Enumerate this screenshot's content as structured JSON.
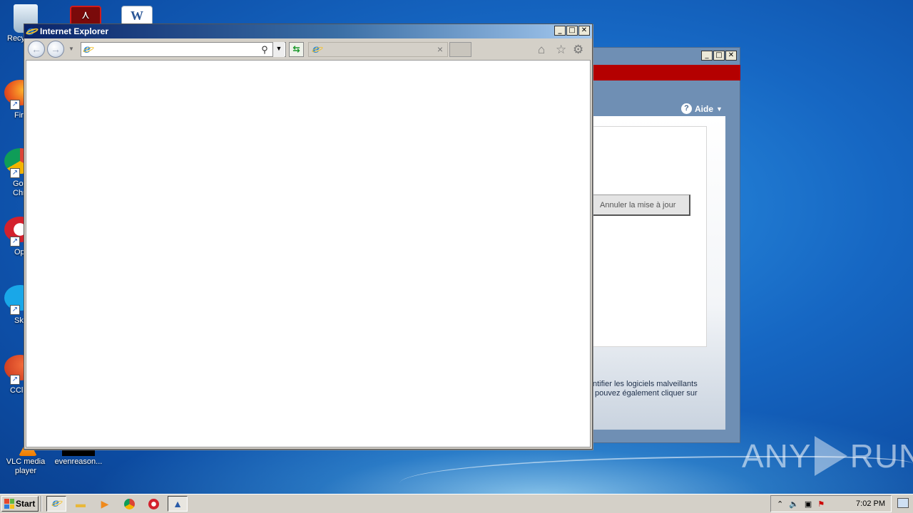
{
  "desktop": {
    "top_icons": [
      {
        "label": "Recy",
        "icon": "recycle-bin-icon"
      },
      {
        "label": "",
        "icon": "acrobat-icon"
      },
      {
        "label": "",
        "icon": "word-document-icon"
      }
    ],
    "left_icons": [
      {
        "label": "Fir",
        "icon": "firefox-icon",
        "color": "#e8561f"
      },
      {
        "label": "Go Chr",
        "icon": "chrome-icon",
        "color": "#2fa84f"
      },
      {
        "label": "Op",
        "icon": "opera-icon",
        "color": "#d3212d"
      },
      {
        "label": "Sk",
        "icon": "skype-icon",
        "color": "#19a7e8"
      },
      {
        "label": "CCl",
        "icon": "ccleaner-icon",
        "color": "#d84a2a"
      }
    ],
    "bottom_icons": [
      {
        "label": "VLC media player",
        "icon": "vlc-icon"
      },
      {
        "label": "evenreason...",
        "icon": "file-icon"
      }
    ]
  },
  "bg_window": {
    "help_label": "Aide",
    "cancel_button": "Annuler la mise à jour",
    "description_line1": "ntifier les logiciels malveillants",
    "description_line2": "pouvez également cliquer sur",
    "accent_color": "#b40000"
  },
  "ie_window": {
    "title": "Internet Explorer",
    "address_value": "",
    "tab_title": "",
    "controls": {
      "minimize": "_",
      "maximize": "□",
      "close": "✕"
    }
  },
  "taskbar": {
    "start_label": "Start",
    "apps": [
      "ie-icon",
      "explorer-icon",
      "media-player-icon",
      "chrome-icon",
      "opera-icon",
      "setup-icon"
    ],
    "clock": "7:02 PM"
  },
  "watermark": {
    "left": "ANY",
    "right": "RUN"
  }
}
